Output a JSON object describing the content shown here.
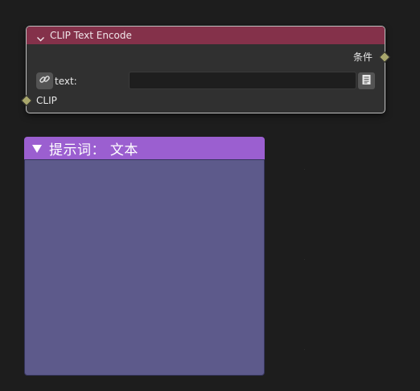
{
  "clip_node": {
    "title": "CLIP Text Encode",
    "output_label": "条件",
    "text_label": "text:",
    "text_value": "",
    "input_label": "CLIP",
    "colors": {
      "header": "#84314a",
      "body": "#303030",
      "socket": "#a9a76c"
    },
    "icons": [
      "chevron-down-icon",
      "link-icon",
      "text-document-icon"
    ]
  },
  "prompt_frame": {
    "title": "提示词： 文本",
    "colors": {
      "header": "#9b5fd0",
      "body": "#5d5a8b"
    },
    "icons": [
      "triangle-down-icon"
    ]
  }
}
